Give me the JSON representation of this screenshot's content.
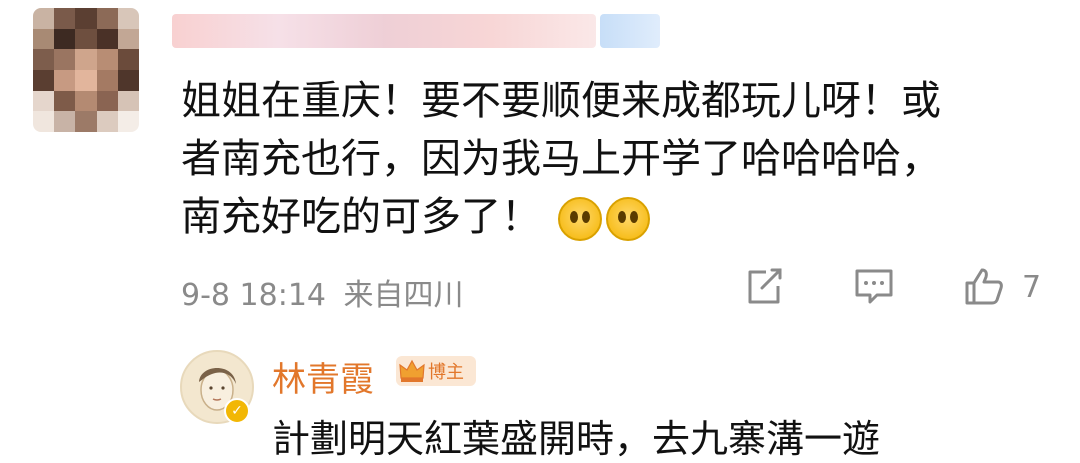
{
  "comment": {
    "text_lines": [
      "姐姐在重庆！要不要顺便来成都玩儿呀！或",
      "者南充也行，因为我马上开学了哈哈哈哈，",
      "南充好吃的可多了！"
    ],
    "emoji_icon": "pray-emoji-icon",
    "timestamp": "9-8 18:14",
    "location": "来自四川",
    "like_count": "7"
  },
  "reply": {
    "author": "林青霞",
    "badge_label": "博主",
    "text": "計劃明天紅葉盛開時，去九寨溝一遊"
  },
  "colors": {
    "accent": "#e2772b",
    "meta": "#8a8a8a",
    "text": "#111111"
  }
}
